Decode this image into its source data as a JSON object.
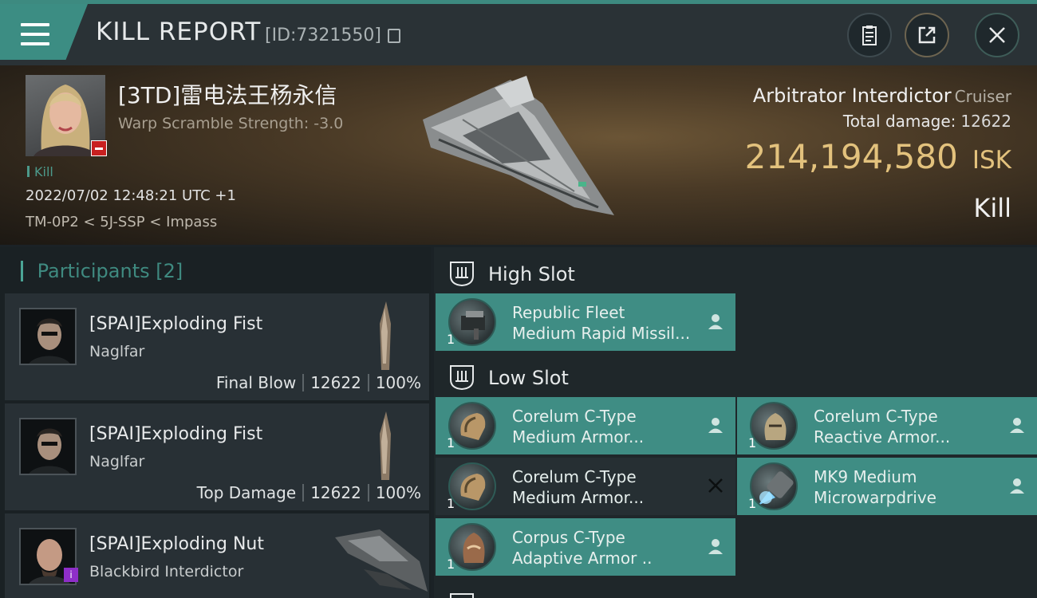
{
  "header": {
    "title": "KILL REPORT",
    "report_id": "[ID:7321550]",
    "icons": [
      "menu-icon",
      "copy-icon",
      "clipboard-icon",
      "share-icon",
      "close-icon"
    ]
  },
  "victim": {
    "name": "[3TD]雷电法王杨永信",
    "warp_scramble": "Warp Scramble Strength: -3.0",
    "kill_tag": "Kill",
    "datetime": "2022/07/02 12:48:21 UTC +1",
    "location": "TM-0P2 < 5J-SSP < Impass",
    "ship": "Arbitrator Interdictor",
    "ship_class": "Cruiser",
    "total_damage_label": "Total damage:",
    "total_damage": "12622",
    "isk_value": "214,194,580",
    "isk_unit": "ISK",
    "result": "Kill"
  },
  "participants": {
    "label": "Participants",
    "count": "[2]",
    "rows": [
      {
        "name": "[SPAI]Exploding Fist",
        "ship": "Naglfar",
        "role": "Final Blow",
        "damage": "12622",
        "percent": "100%"
      },
      {
        "name": "[SPAI]Exploding Fist",
        "ship": "Naglfar",
        "role": "Top Damage",
        "damage": "12622",
        "percent": "100%"
      },
      {
        "name": "[SPAI]Exploding Nut",
        "ship": "Blackbird Interdictor",
        "badge": "i"
      }
    ]
  },
  "fitting": {
    "high_slot": "High Slot",
    "low_slot": "Low Slot",
    "items": [
      {
        "line1": "Republic Fleet",
        "line2": "Medium Rapid Missil...",
        "qty": "1",
        "status": "person-icon"
      },
      {
        "line1": "Corelum C-Type",
        "line2": "Medium Armor...",
        "qty": "1",
        "status": "person-icon"
      },
      {
        "line1": "Corelum C-Type",
        "line2": "Reactive Armor...",
        "qty": "1",
        "status": "person-icon"
      },
      {
        "line1": "Corelum C-Type",
        "line2": "Medium Armor...",
        "qty": "1",
        "status": "destroyed-x-icon"
      },
      {
        "line1": "MK9 Medium",
        "line2": "Microwarpdrive",
        "qty": "1",
        "status": "person-icon"
      },
      {
        "line1": "Corpus C-Type",
        "line2": "Adaptive Armor ..",
        "qty": "1",
        "status": "person-icon"
      }
    ]
  },
  "colors": {
    "accent": "#3f8d84",
    "isk": "#e3c27d",
    "header": "#2a3236"
  }
}
